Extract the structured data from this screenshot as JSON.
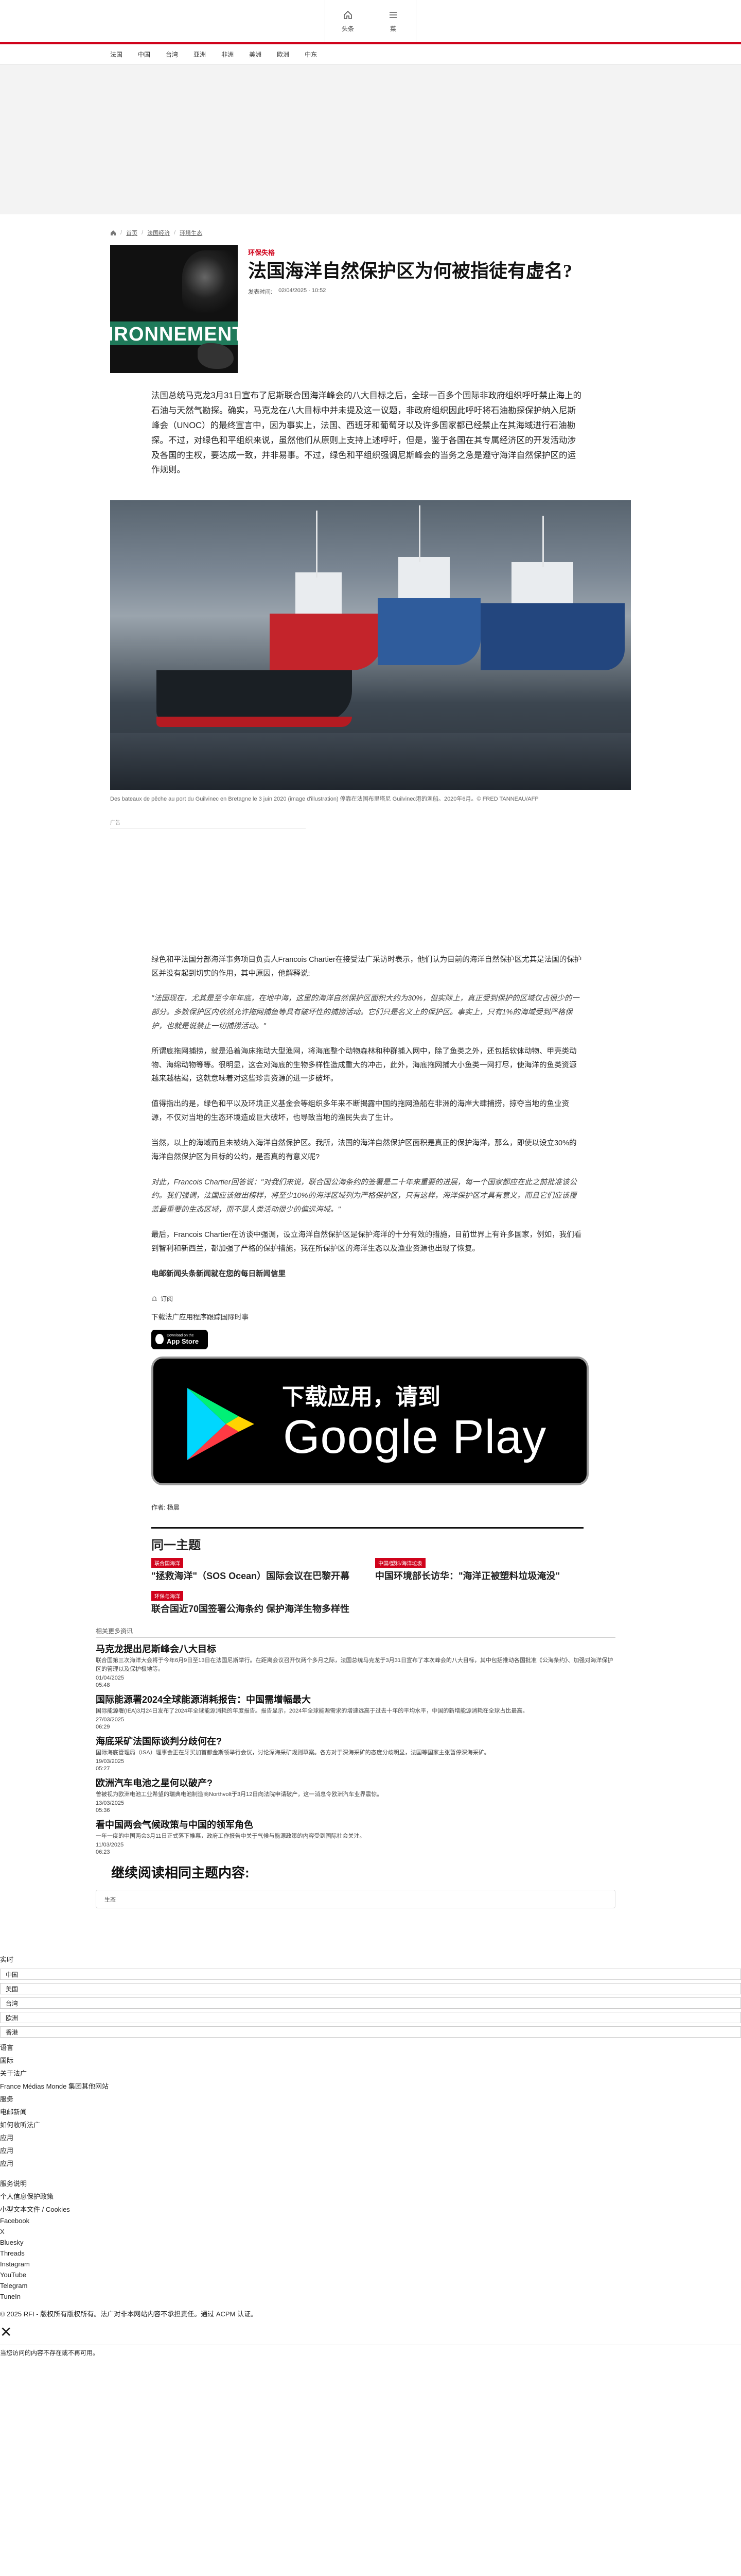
{
  "topbar": {
    "buttons": [
      {
        "label": "头条"
      },
      {
        "label": "菜"
      }
    ]
  },
  "nav": {
    "items": [
      "法国",
      "中国",
      "台湾",
      "亚洲",
      "非洲",
      "美洲",
      "欧洲",
      "中东"
    ]
  },
  "breadcrumb": {
    "items": [
      "首页",
      "法国经济",
      "环境生态"
    ]
  },
  "article": {
    "kicker": "环保失格",
    "title": "法国海洋自然保护区为何被指徒有虚名?",
    "published_label": "发表时间:",
    "published": "02/04/2025 · 10:52",
    "thumb_word": "IRONNEMENT",
    "lead": "法国总统马克龙3月31日宣布了尼斯联合国海洋峰会的八大目标之后，全球一百多个国际非政府组织呼吁禁止海上的石油与天然气勘探。确实，马克龙在八大目标中并未提及这一议题，非政府组织因此呼吁将石油勘探保护纳入尼斯峰会（UNOC）的最终宣言中，因为事实上，法国、西班牙和葡萄牙以及许多国家都已经禁止在其海域进行石油勘探。不过，对绿色和平组织来说，虽然他们从原则上支持上述呼吁，但是，鉴于各国在其专属经济区的开发活动涉及各国的主权，要达成一致，并非易事。不过，绿色和平组织强调尼斯峰会的当务之急是遵守海洋自然保护区的运作规则。",
    "image_caption": "Des bateaux de pêche au port du Guilvinec en Bretagne le 3 juin 2020 (image d'illustration) 停靠在法国布里塔尼 Guilvinec港的渔船。2020年6月。© FRED TANNEAU/AFP",
    "ad_label": "广告",
    "paragraphs": [
      {
        "type": "normal",
        "text": "绿色和平法国分部海洋事务项目负责人Francois Chartier在接受法广采访时表示，他们认为目前的海洋自然保护区尤其是法国的保护区并没有起到切实的作用，其中原因，他解释说:"
      },
      {
        "type": "quote",
        "text": "\"法国现在，尤其是至今年年底，在地中海，这里的海洋自然保护区面积大约为30%，但实际上，真正受到保护的区域仅占很少的一部分。多数保护区内依然允许拖网捕鱼等具有破坏性的捕捞活动。它们只是名义上的保护区。事实上，只有1%的海域受到严格保护，也就是说禁止一切捕捞活动。\""
      },
      {
        "type": "normal",
        "text": "所谓底拖网捕捞，就是沿着海床拖动大型渔网，将海底整个动物森林和种群捕入网中，除了鱼类之外，还包括软体动物、甲壳类动物、海绵动物等等。很明显，这会对海底的生物多样性造成重大的冲击，此外，海底拖网捕大小鱼类一网打尽，使海洋的鱼类资源越来越枯竭，这就意味着对这些珍贵资源的进一步破坏。"
      },
      {
        "type": "normal",
        "text": "值得指出的是，绿色和平以及环境正义基金会等组织多年来不断揭露中国的拖网渔船在非洲的海岸大肆捕捞，掠夺当地的鱼业资源，不仅对当地的生态环境造成巨大破坏，也导致当地的渔民失去了生计。"
      },
      {
        "type": "normal",
        "text": "当然，以上的海域而且未被纳入海洋自然保护区。我所，法国的海洋自然保护区面积是真正的保护海洋，那么，即使以设立30%的海洋自然保护区为目标的公约，是否真的有意义呢?"
      },
      {
        "type": "quote",
        "text": "对此，Francois Chartier回答说：\"对我们来说，联合国公海条约的签署是二十年来重要的进展，每一个国家都应在此之前批准该公约。我们强调，法国应该做出榜样，将至少10%的海洋区域列为严格保护区，只有这样，海洋保护区才具有意义，而且它们应该覆盖最重要的生态区域，而不是人类活动很少的偏远海域。\""
      },
      {
        "type": "normal",
        "text": "最后，Francois Chartier在访谈中强调，设立海洋自然保护区是保护海洋的十分有效的措施，目前世界上有许多国家，例如，我们看到智利和新西兰，都加强了严格的保护措施，我在所保护区的海洋生态以及渔业资源也出现了恢复。"
      },
      {
        "type": "more",
        "text": "电邮新闻头条新闻就在您的每日新闻信里"
      }
    ],
    "share_label": "订阅",
    "download_text": "下载法广应用程序跟踪国际时事",
    "appstore": {
      "small": "Download on the",
      "big": "App Store"
    },
    "gplay": {
      "line1": "下载应用，请到",
      "line2": "Google Play"
    },
    "author_label": "作者:",
    "author": "杨晨"
  },
  "related": {
    "title": "同一主题",
    "items": [
      {
        "badge": "联合国海洋",
        "title": "\"拯救海洋\"（SOS Ocean）国际会议在巴黎开幕"
      },
      {
        "badge": "中国/塑料/海洋垃圾",
        "title": "中国环境部长访华：\"海洋正被塑料垃圾淹没\""
      },
      {
        "badge": "环保与海洋",
        "title": "联合国近70国签署公海条约 保护海洋生物多样性"
      }
    ]
  },
  "reading": {
    "label": "相关更多资讯",
    "items": [
      {
        "title": "马克龙提出尼斯峰会八大目标",
        "text": "联合国第三次海洋大会将于今年6月9日至13日在法国尼斯举行。在距离会议召开仅两个多月之际，法国总统马克龙于3月31日宣布了本次峰会的八大目标，其中包括推动各国批准《公海条约》、加强对海洋保护区的管理以及保护极地等。",
        "date": "01/04/2025",
        "date2": "05:48"
      },
      {
        "title": "国际能源署2024全球能源消耗报告：中国需增幅最大",
        "text": "国际能源署(IEA)3月24日发布了2024年全球能源消耗的年度报告。报告显示，2024年全球能源需求的增速远高于过去十年的平均水平，中国的新增能源消耗在全球占比最高。",
        "date": "27/03/2025",
        "date2": "06:29"
      },
      {
        "title": "海底采矿法国际谈判分歧何在?",
        "text": "国际海底管理局（ISA）理事会正在牙买加首都金斯顿举行会议，讨论深海采矿规则草案。各方对于深海采矿的态度分歧明显，法国等国家主张暂停深海采矿。",
        "date": "19/03/2025",
        "date2": "05:27"
      },
      {
        "title": "欧洲汽车电池之星何以破产?",
        "text": "曾被视为欧洲电池工业希望的瑞典电池制造商Northvolt于3月12日向法院申请破产，这一消息令欧洲汽车业界震惊。",
        "date": "13/03/2025",
        "date2": "05:36"
      },
      {
        "title": "看中国两会气候政策与中国的领军角色",
        "text": "一年一度的中国两会3月11日正式落下帷幕，政府工作报告中关于气候与能源政策的内容受到国际社会关注。",
        "date": "11/03/2025",
        "date2": "06:23"
      }
    ]
  },
  "topics": {
    "title": "继续阅读相同主题内容:",
    "chip": "生态"
  },
  "footer": {
    "items": [
      "实时",
      "中国",
      "美国",
      "台湾",
      "欧洲",
      "香港"
    ],
    "lang_label": "语言",
    "links": [
      "国际",
      "关于法广",
      "France Médias Monde 集团其他网站",
      "服务",
      "电邮新闻",
      "如何收听法广",
      "应用",
      "应用",
      "应用"
    ],
    "legal": [
      "服务说明",
      "个人信息保护政策",
      "小型文本文件 / Cookies",
      "Facebook",
      "X",
      "Bluesky",
      "Threads",
      "Instagram",
      "YouTube",
      "Telegram",
      "TuneIn"
    ],
    "copyright": "© 2025 RFI - 版权所有版权所有。法广对非本网站内容不承担责任。通过 ACPM 认证。",
    "close_label": "✕",
    "consent": "当您访问的内容不存在或不再可用。"
  }
}
